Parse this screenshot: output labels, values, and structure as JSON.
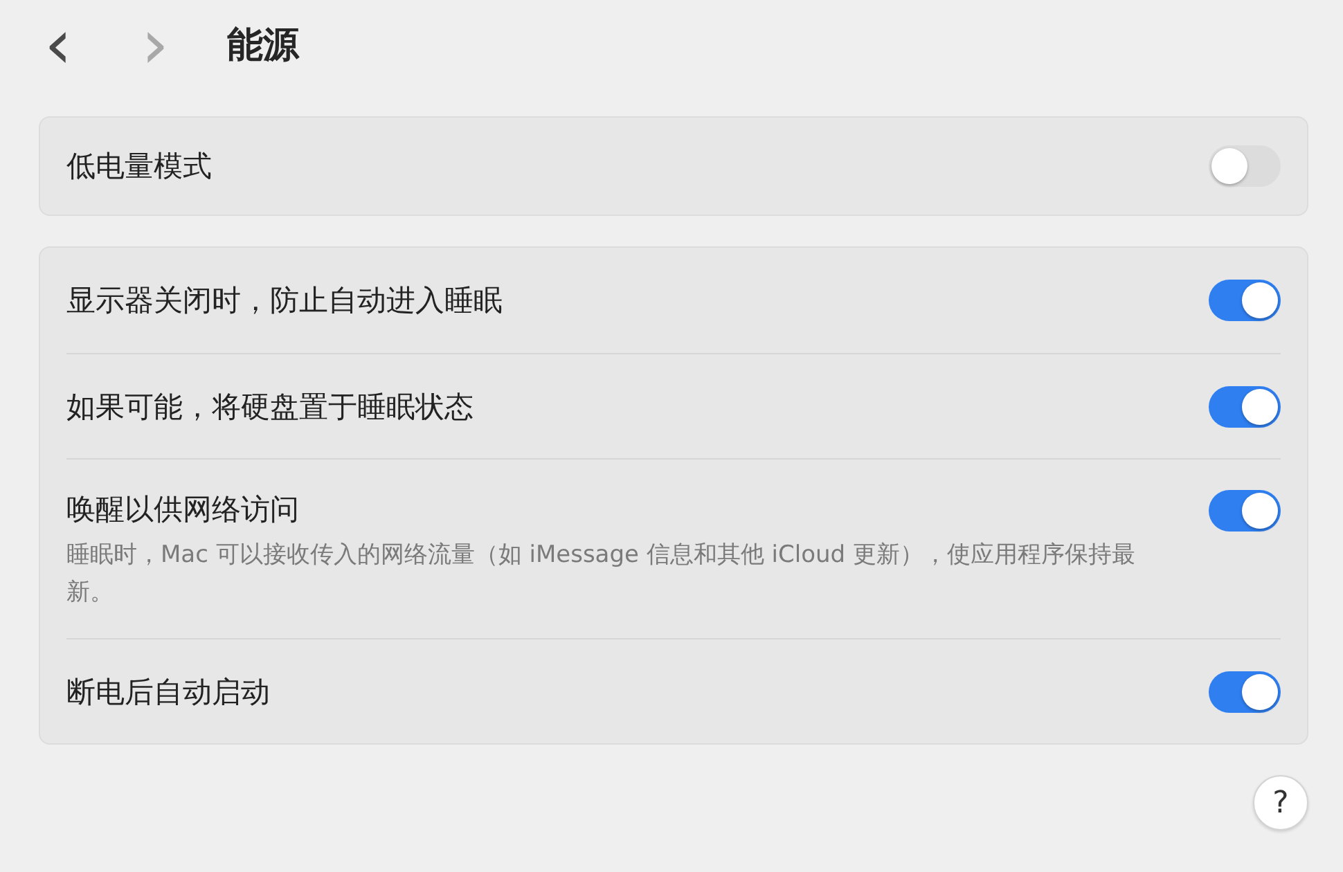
{
  "nav": {
    "back": "‹",
    "forward": "›",
    "forward_disabled": true
  },
  "title": "能源",
  "sections": [
    {
      "rows": [
        {
          "label": "低电量模式",
          "on": false
        }
      ]
    },
    {
      "rows": [
        {
          "label": "显示器关闭时，防止自动进入睡眠",
          "on": true
        },
        {
          "label": "如果可能，将硬盘置于睡眠状态",
          "on": true
        },
        {
          "label": "唤醒以供网络访问",
          "description": "睡眠时，Mac 可以接收传入的网络流量（如 iMessage 信息和其他 iCloud 更新），使应用程序保持最新。",
          "on": true
        },
        {
          "label": "断电后自动启动",
          "on": true
        }
      ]
    }
  ],
  "help": "?"
}
